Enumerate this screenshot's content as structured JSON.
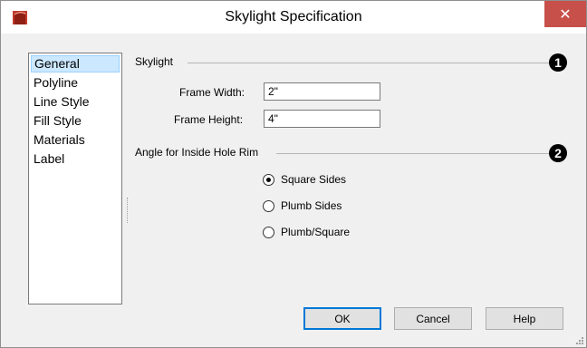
{
  "window": {
    "title": "Skylight Specification",
    "close_glyph": "✕",
    "accent_color": "#c7504a"
  },
  "sidebar": {
    "items": [
      {
        "label": "General",
        "selected": true
      },
      {
        "label": "Polyline"
      },
      {
        "label": "Line Style"
      },
      {
        "label": "Fill Style"
      },
      {
        "label": "Materials"
      },
      {
        "label": "Label"
      }
    ]
  },
  "skylight_group": {
    "label": "Skylight",
    "badge": "1",
    "frame_width_label": "Frame Width:",
    "frame_width_value": "2\"",
    "frame_height_label": "Frame Height:",
    "frame_height_value": "4\""
  },
  "angle_group": {
    "label": "Angle for Inside Hole Rim",
    "badge": "2",
    "options": [
      {
        "label": "Square Sides",
        "checked": true
      },
      {
        "label": "Plumb Sides",
        "checked": false
      },
      {
        "label": "Plumb/Square",
        "checked": false
      }
    ]
  },
  "buttons": {
    "ok": "OK",
    "cancel": "Cancel",
    "help": "Help"
  },
  "icons": {
    "app": "app-logo-icon",
    "close": "close-icon",
    "resize": "resize-grip-icon"
  }
}
